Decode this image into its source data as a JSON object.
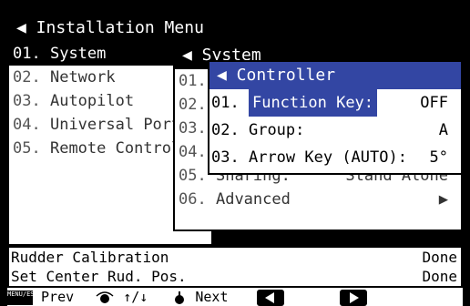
{
  "installation_menu": {
    "title": "◀ Installation Menu",
    "items": [
      {
        "num": "01.",
        "label": "System"
      },
      {
        "num": "02.",
        "label": "Network"
      },
      {
        "num": "03.",
        "label": "Autopilot"
      },
      {
        "num": "04.",
        "label": "Universal Port"
      },
      {
        "num": "05.",
        "label": "Remote Controller"
      }
    ]
  },
  "system_menu": {
    "title": "◀ System",
    "items": [
      {
        "num": "01.",
        "label": "",
        "value": ""
      },
      {
        "num": "02.",
        "label": "",
        "value": ""
      },
      {
        "num": "03.",
        "label": "",
        "value": ""
      },
      {
        "num": "04.",
        "label": "",
        "value": ""
      },
      {
        "num": "05.",
        "label": "Sharing:",
        "value": "Stand Alone"
      },
      {
        "num": "06.",
        "label": "Advanced",
        "value": "▶"
      }
    ]
  },
  "controller_menu": {
    "title": "◀ Controller",
    "items": [
      {
        "num": "01.",
        "label": "Function Key:",
        "value": "OFF"
      },
      {
        "num": "02.",
        "label": "Group:",
        "value": "A"
      },
      {
        "num": "03.",
        "label": "Arrow Key (AUTO):",
        "value": "5°"
      }
    ]
  },
  "status": {
    "rows": [
      {
        "label": "Rudder Calibration",
        "value": "Done"
      },
      {
        "label": "Set Center Rud. Pos.",
        "value": "Done"
      }
    ]
  },
  "keybar": {
    "menu_key": "MENU/ESC",
    "prev": "Prev",
    "updown": "↑/↓",
    "next": "Next"
  }
}
